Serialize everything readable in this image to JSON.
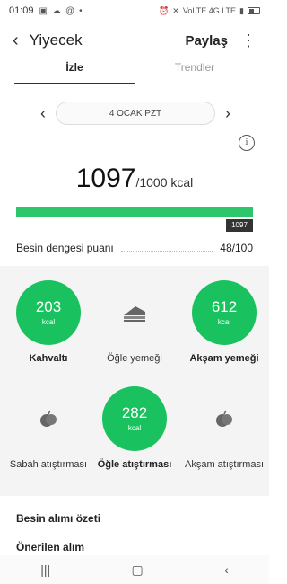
{
  "status": {
    "time": "01:09",
    "right_text": "VoLTE 4G LTE"
  },
  "header": {
    "title": "Yiyecek",
    "share_label": "Paylaş",
    "more_icon": "more-vert-icon"
  },
  "tabs": [
    {
      "label": "İzle",
      "active": true
    },
    {
      "label": "Trendler",
      "active": false
    }
  ],
  "date": {
    "label": "4 OCAK PZT"
  },
  "intake": {
    "kcal_consumed": "1097",
    "kcal_goal": "/1000 kcal",
    "progress_badge": "1097",
    "progress_fraction": 1.0
  },
  "balance": {
    "label": "Besin dengesi puanı",
    "score": "48/100"
  },
  "meals": [
    {
      "label": "Kahvaltı",
      "value": "203",
      "unit": "kcal",
      "filled": true
    },
    {
      "label": "Öğle yemeği",
      "value": "",
      "unit": "",
      "filled": false,
      "icon": "sandwich-icon"
    },
    {
      "label": "Akşam yemeği",
      "value": "612",
      "unit": "kcal",
      "filled": true
    },
    {
      "label": "Sabah atıştırması",
      "value": "",
      "unit": "",
      "filled": false,
      "icon": "fruit-icon"
    },
    {
      "label": "Öğle atıştırması",
      "value": "282",
      "unit": "kcal",
      "filled": true
    },
    {
      "label": "Akşam atıştırması",
      "value": "",
      "unit": "",
      "filled": false,
      "icon": "fruit-icon"
    }
  ],
  "summary": {
    "title": "Besin alımı özeti",
    "subtitle": "Önerilen alım"
  },
  "colors": {
    "accent_green": "#19c25f",
    "progress_green": "#2ec66a"
  }
}
